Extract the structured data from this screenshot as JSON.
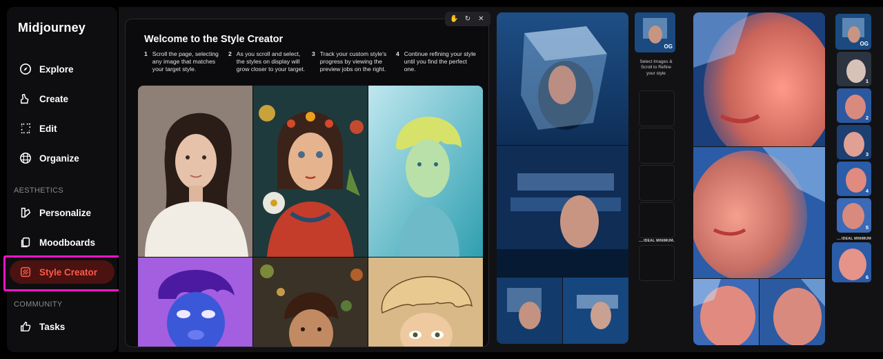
{
  "app": {
    "brand": "Midjourney"
  },
  "sidebar": {
    "items_top": [
      {
        "label": "Explore",
        "icon": "compass-icon"
      },
      {
        "label": "Create",
        "icon": "brush-icon"
      },
      {
        "label": "Edit",
        "icon": "edit-frame-icon"
      },
      {
        "label": "Organize",
        "icon": "grid-globe-icon"
      }
    ],
    "aesthetics_label": "AESTHETICS",
    "items_aesthetics": [
      {
        "label": "Personalize",
        "icon": "personalize-icon"
      },
      {
        "label": "Moodboards",
        "icon": "moodboard-icon"
      },
      {
        "label": "Style Creator",
        "icon": "style-creator-icon",
        "active": true
      }
    ],
    "community_label": "COMMUNITY",
    "items_community": [
      {
        "label": "Tasks",
        "icon": "thumbs-up-icon"
      }
    ]
  },
  "style_creator": {
    "title": "Welcome to the Style Creator",
    "steps": [
      {
        "num": "1",
        "text": "Scroll the page, selecting any image that matches your target style."
      },
      {
        "num": "2",
        "text": "As you scroll and select, the styles on display will grow closer to your target."
      },
      {
        "num": "3",
        "text": "Track your custom style's progress by viewing the preview jobs on the right."
      },
      {
        "num": "4",
        "text": "Continue refining your style until you find the perfect one."
      }
    ],
    "images": [
      "portrait-woman-photo",
      "folk-art-woman",
      "watercolor-boy",
      "purple-curly-portrait",
      "floral-mosaic-boy",
      "comic-curly-boy"
    ]
  },
  "preview_left": {
    "og_label": "OG",
    "select_hint": "Select Images & Scroll to Refine your style",
    "ideal_label": "IDEAL MINIMUM"
  },
  "preview_right": {
    "og_label": "OG",
    "numbers": [
      "1",
      "2",
      "3",
      "4",
      "5",
      "6"
    ],
    "ideal_label": "IDEAL MINIMUM"
  },
  "colors": {
    "accent": "#ff5a48",
    "active_bg": "#4a1211",
    "highlight_box": "#ff14c4"
  }
}
